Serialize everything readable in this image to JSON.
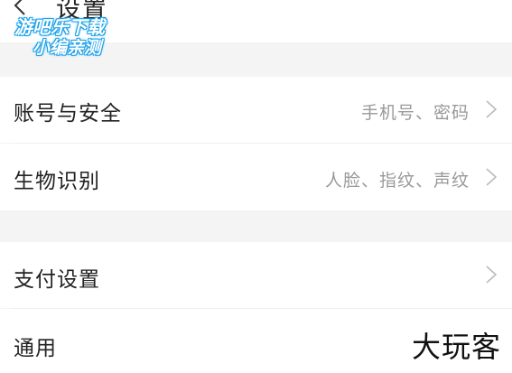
{
  "header": {
    "title": "设置",
    "back_icon": "chevron-left-icon"
  },
  "watermark_top": {
    "line1": "游吧乐下载",
    "line2": "小编亲测"
  },
  "section1": {
    "items": [
      {
        "label": "账号与安全",
        "value": "手机号、密码",
        "icon": "chevron-right-icon"
      },
      {
        "label": "生物识别",
        "value": "人脸、指纹、声纹",
        "icon": "chevron-right-icon"
      }
    ]
  },
  "section2": {
    "items": [
      {
        "label": "支付设置",
        "value": "",
        "icon": "chevron-right-icon"
      },
      {
        "label": "通用",
        "value": ""
      }
    ]
  },
  "watermark_bottom": "大玩客",
  "colors": {
    "background": "#f4f4f4",
    "row_background": "#ffffff",
    "label_text": "#222222",
    "value_text": "#999999",
    "watermark_outline": "#1aa0e8"
  }
}
